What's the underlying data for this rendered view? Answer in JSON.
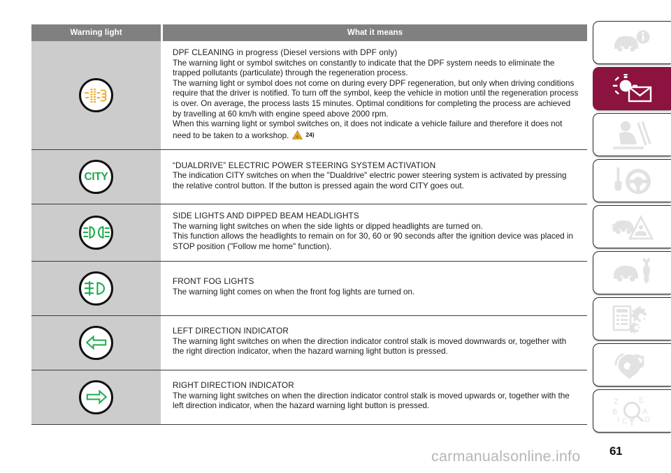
{
  "page": {
    "number": "61",
    "watermark": "carmanualsonline.info"
  },
  "table": {
    "headers": {
      "icon_col": "Warning light",
      "desc_col": "What it means"
    },
    "rows": [
      {
        "icon_name": "dpf-cleaning-warning-icon",
        "icon_label": "DPF filter symbol",
        "icon_color": "#ecab1e",
        "title": "DPF CLEANING in progress (Diesel versions with DPF only)",
        "body": "The warning light or symbol switches on constantly to indicate that the DPF system needs to eliminate the trapped pollutants (particulate) through the regeneration process.\nThe warning light or symbol does not come on during every DPF regeneration, but only when driving conditions require that the driver is notified. To turn off the symbol, keep the vehicle in motion until the regeneration process is over. On average, the process lasts 15 minutes. Optimal conditions for completing the process are achieved by travelling at 60 km/h with engine speed above 2000 rpm.\nWhen this warning light or symbol switches on, it does not indicate a vehicle failure and therefore it does not need to be taken to a workshop.",
        "footnote": "24)"
      },
      {
        "icon_name": "city-dualdrive-warning-icon",
        "icon_label": "CITY",
        "icon_color": "#1faa4b",
        "title": "“DUALDRIVE” ELECTRIC POWER STEERING SYSTEM ACTIVATION",
        "body": "The indication CITY switches on when the \"Dualdrive\" electric power steering system is activated by pressing the relative control button. If the button is pressed again the word CITY goes out.",
        "footnote": ""
      },
      {
        "icon_name": "side-lights-dipped-beam-warning-icon",
        "icon_label": "Side lights and dipped beam headlights symbol",
        "icon_color": "#1faa4b",
        "title": "SIDE LIGHTS AND DIPPED BEAM HEADLIGHTS",
        "body": "The warning light switches on when the side lights or dipped headlights are turned on.\nThis function allows the headlights to remain on for 30, 60 or 90 seconds after the ignition device was placed in STOP position (\"Follow me home\" function).",
        "footnote": ""
      },
      {
        "icon_name": "front-fog-lights-warning-icon",
        "icon_label": "Front fog lights symbol",
        "icon_color": "#1faa4b",
        "title": "FRONT FOG LIGHTS",
        "body": "The warning light comes on when the front fog lights are turned on.",
        "footnote": ""
      },
      {
        "icon_name": "left-direction-indicator-warning-icon",
        "icon_label": "Left arrow",
        "icon_color": "#1faa4b",
        "title": "LEFT DIRECTION INDICATOR",
        "body": "The warning light switches on when the direction indicator control stalk is moved downwards or, together with the right direction indicator, when the hazard warning light button is pressed.",
        "footnote": ""
      },
      {
        "icon_name": "right-direction-indicator-warning-icon",
        "icon_label": "Right arrow",
        "icon_color": "#1faa4b",
        "title": "RIGHT DIRECTION INDICATOR",
        "body": "The warning light switches on when the direction indicator control stalk is moved upwards or, together with the left direction indicator, when the hazard warning light button is pressed.",
        "footnote": ""
      }
    ]
  },
  "rail": {
    "active_index": 1,
    "active_color": "#8c1240",
    "inactive_icon_color": "#e2e2e2",
    "tabs": [
      {
        "name": "tab-dashboard-and-controls",
        "icon": "car-info-icon"
      },
      {
        "name": "tab-warning-lights-and-messages",
        "icon": "warning-light-message-icon"
      },
      {
        "name": "tab-safety",
        "icon": "seatbelt-occupant-icon"
      },
      {
        "name": "tab-starting-and-driving",
        "icon": "key-steering-wheel-icon"
      },
      {
        "name": "tab-in-emergency",
        "icon": "car-breakdown-warning-triangle-icon"
      },
      {
        "name": "tab-maintenance-and-care",
        "icon": "car-wrench-icon"
      },
      {
        "name": "tab-technical-specifications",
        "icon": "spec-list-gears-icon"
      },
      {
        "name": "tab-multimedia",
        "icon": "radio-music-note-icon"
      },
      {
        "name": "tab-alphabetical-index",
        "icon": "index-magnifier-icon"
      }
    ]
  }
}
